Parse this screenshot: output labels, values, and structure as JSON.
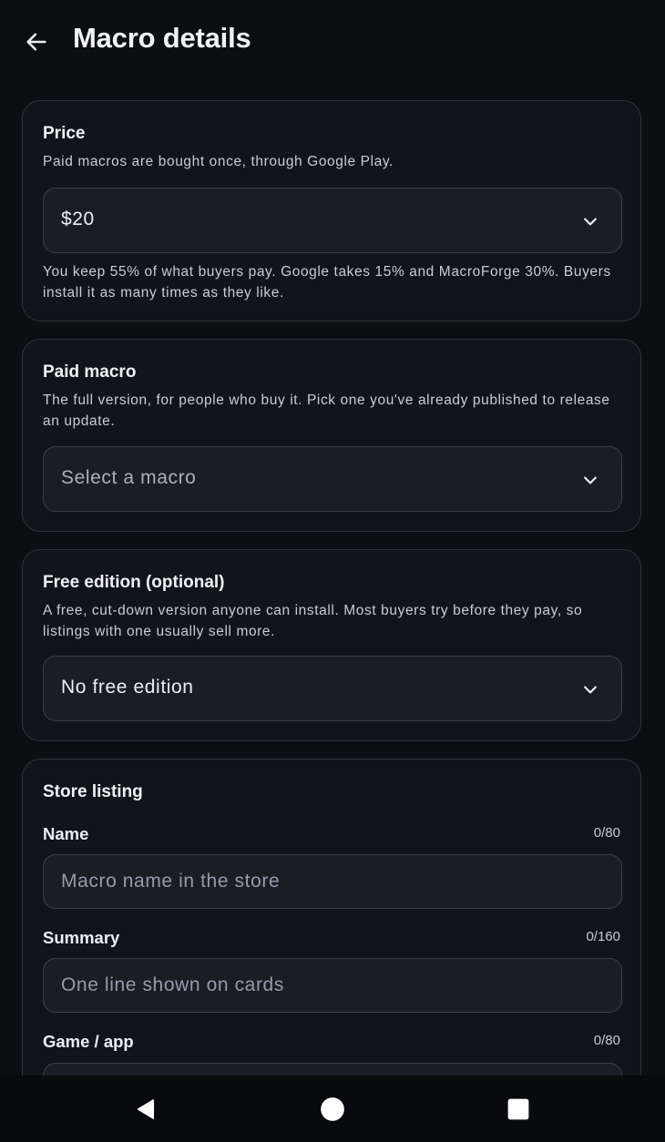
{
  "header": {
    "title": "Macro details",
    "back_icon": "arrow-left-icon"
  },
  "price": {
    "title": "Price",
    "description": "Paid macros are bought once, through Google Play.",
    "selected_value": "$20",
    "note": "You keep 55% of what buyers pay. Google takes 15% and MacroForge 30%. Buyers install it as many times as they like."
  },
  "paid_macro": {
    "title": "Paid macro",
    "description": "The full version, for people who buy it. Pick one you've already published to release an update.",
    "placeholder": "Select a macro"
  },
  "free_edition": {
    "title": "Free edition (optional)",
    "description": "A free, cut-down version anyone can install. Most buyers try before they pay, so listings with one usually sell more.",
    "selected_value": "No free edition"
  },
  "store_listing": {
    "title": "Store listing",
    "name": {
      "label": "Name",
      "counter": "0/80",
      "placeholder": "Macro name in the store",
      "value": ""
    },
    "summary": {
      "label": "Summary",
      "counter": "0/160",
      "placeholder": "One line shown on cards",
      "value": ""
    },
    "game_app": {
      "label": "Game / app",
      "counter": "0/80"
    }
  },
  "nav_bar": {
    "back_icon": "triangle-back-icon",
    "home_icon": "circle-home-icon",
    "recents_icon": "square-recents-icon"
  },
  "colors": {
    "background": "#0d0e12",
    "card": "#13141a",
    "card_border": "#2e313b",
    "field": "#1b1d25",
    "field_border": "#3a3e4a",
    "text_primary": "#eceef3",
    "text_secondary": "#c9ccd6"
  }
}
